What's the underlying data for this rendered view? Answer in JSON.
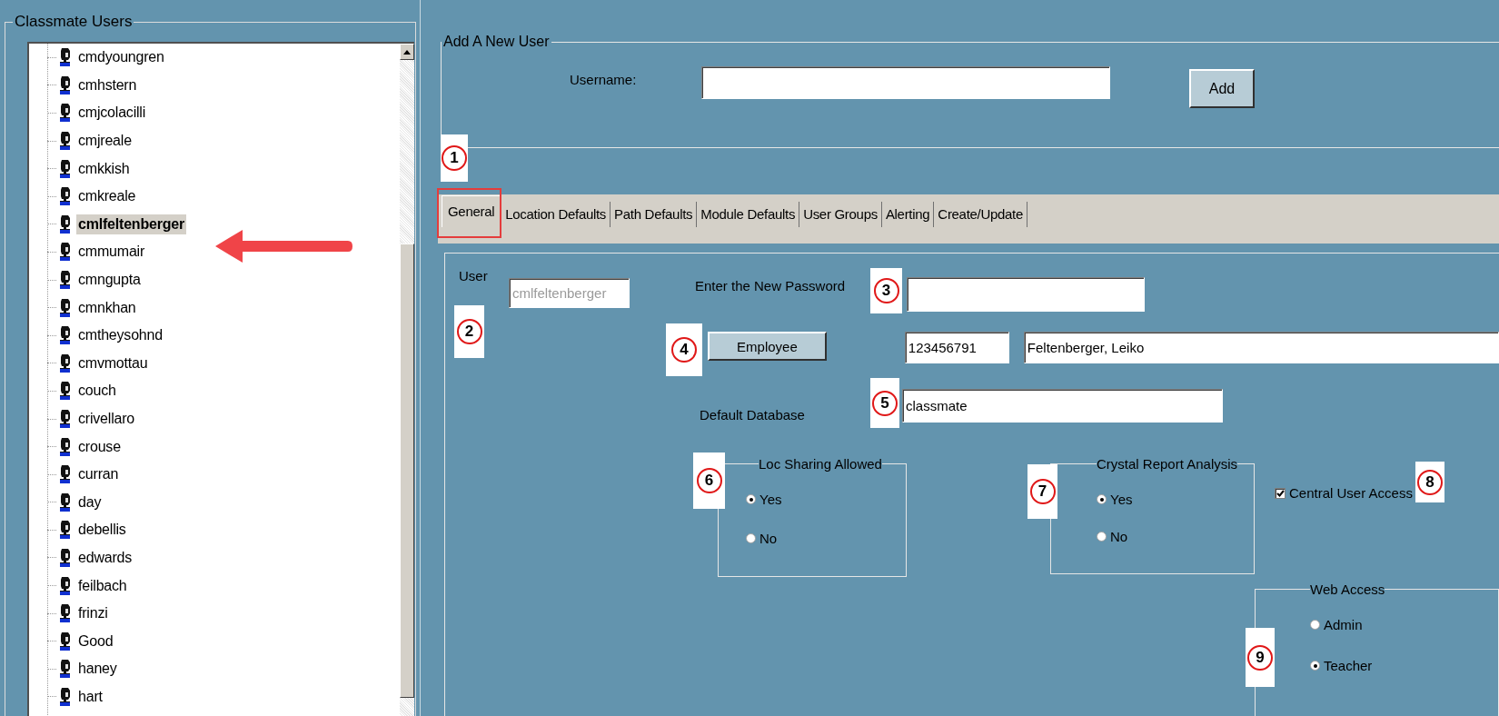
{
  "users_panel": {
    "title": "Classmate Users",
    "users": [
      {
        "name": "cmdyoungren",
        "selected": false
      },
      {
        "name": "cmhstern",
        "selected": false
      },
      {
        "name": "cmjcolacilli",
        "selected": false
      },
      {
        "name": "cmjreale",
        "selected": false
      },
      {
        "name": "cmkkish",
        "selected": false
      },
      {
        "name": "cmkreale",
        "selected": false
      },
      {
        "name": "cmlfeltenberger",
        "selected": true
      },
      {
        "name": "cmmumair",
        "selected": false
      },
      {
        "name": "cmngupta",
        "selected": false
      },
      {
        "name": "cmnkhan",
        "selected": false
      },
      {
        "name": "cmtheysohnd",
        "selected": false
      },
      {
        "name": "cmvmottau",
        "selected": false
      },
      {
        "name": "couch",
        "selected": false
      },
      {
        "name": "crivellaro",
        "selected": false
      },
      {
        "name": "crouse",
        "selected": false
      },
      {
        "name": "curran",
        "selected": false
      },
      {
        "name": "day",
        "selected": false
      },
      {
        "name": "debellis",
        "selected": false
      },
      {
        "name": "edwards",
        "selected": false
      },
      {
        "name": "feilbach",
        "selected": false
      },
      {
        "name": "frinzi",
        "selected": false
      },
      {
        "name": "Good",
        "selected": false
      },
      {
        "name": "haney",
        "selected": false
      },
      {
        "name": "hart",
        "selected": false
      }
    ]
  },
  "add_user": {
    "title": "Add A New User",
    "username_label": "Username:",
    "add_button": "Add"
  },
  "tabs": [
    {
      "label": "General",
      "selected": true
    },
    {
      "label": "Location Defaults",
      "selected": false
    },
    {
      "label": "Path Defaults",
      "selected": false
    },
    {
      "label": "Module Defaults",
      "selected": false
    },
    {
      "label": "User Groups",
      "selected": false
    },
    {
      "label": "Alerting",
      "selected": false
    },
    {
      "label": "Create/Update",
      "selected": false
    }
  ],
  "general": {
    "user_label": "User",
    "user_value": "cmlfeltenberger",
    "user_disabled": true,
    "password_label": "Enter the New Password",
    "employee_button": "Employee",
    "employee_id": "123456791",
    "employee_name": "Feltenberger, Leiko",
    "database_label": "Default Database",
    "database": "classmate",
    "loc_sharing": {
      "title": "Loc Sharing Allowed",
      "options": [
        {
          "label": "Yes",
          "selected": true
        },
        {
          "label": "No",
          "selected": false
        }
      ]
    },
    "crystal_report": {
      "title": "Crystal Report Analysis",
      "options": [
        {
          "label": "Yes",
          "selected": true
        },
        {
          "label": "No",
          "selected": false
        }
      ]
    },
    "central_user_access": {
      "label": "Central User Access",
      "checked": true
    },
    "web_access": {
      "title": "Web Access",
      "options": [
        {
          "label": "Admin",
          "selected": false
        },
        {
          "label": "Teacher",
          "selected": true
        }
      ]
    }
  },
  "callouts": [
    "1",
    "2",
    "3",
    "4",
    "5",
    "6",
    "7",
    "8",
    "9"
  ]
}
